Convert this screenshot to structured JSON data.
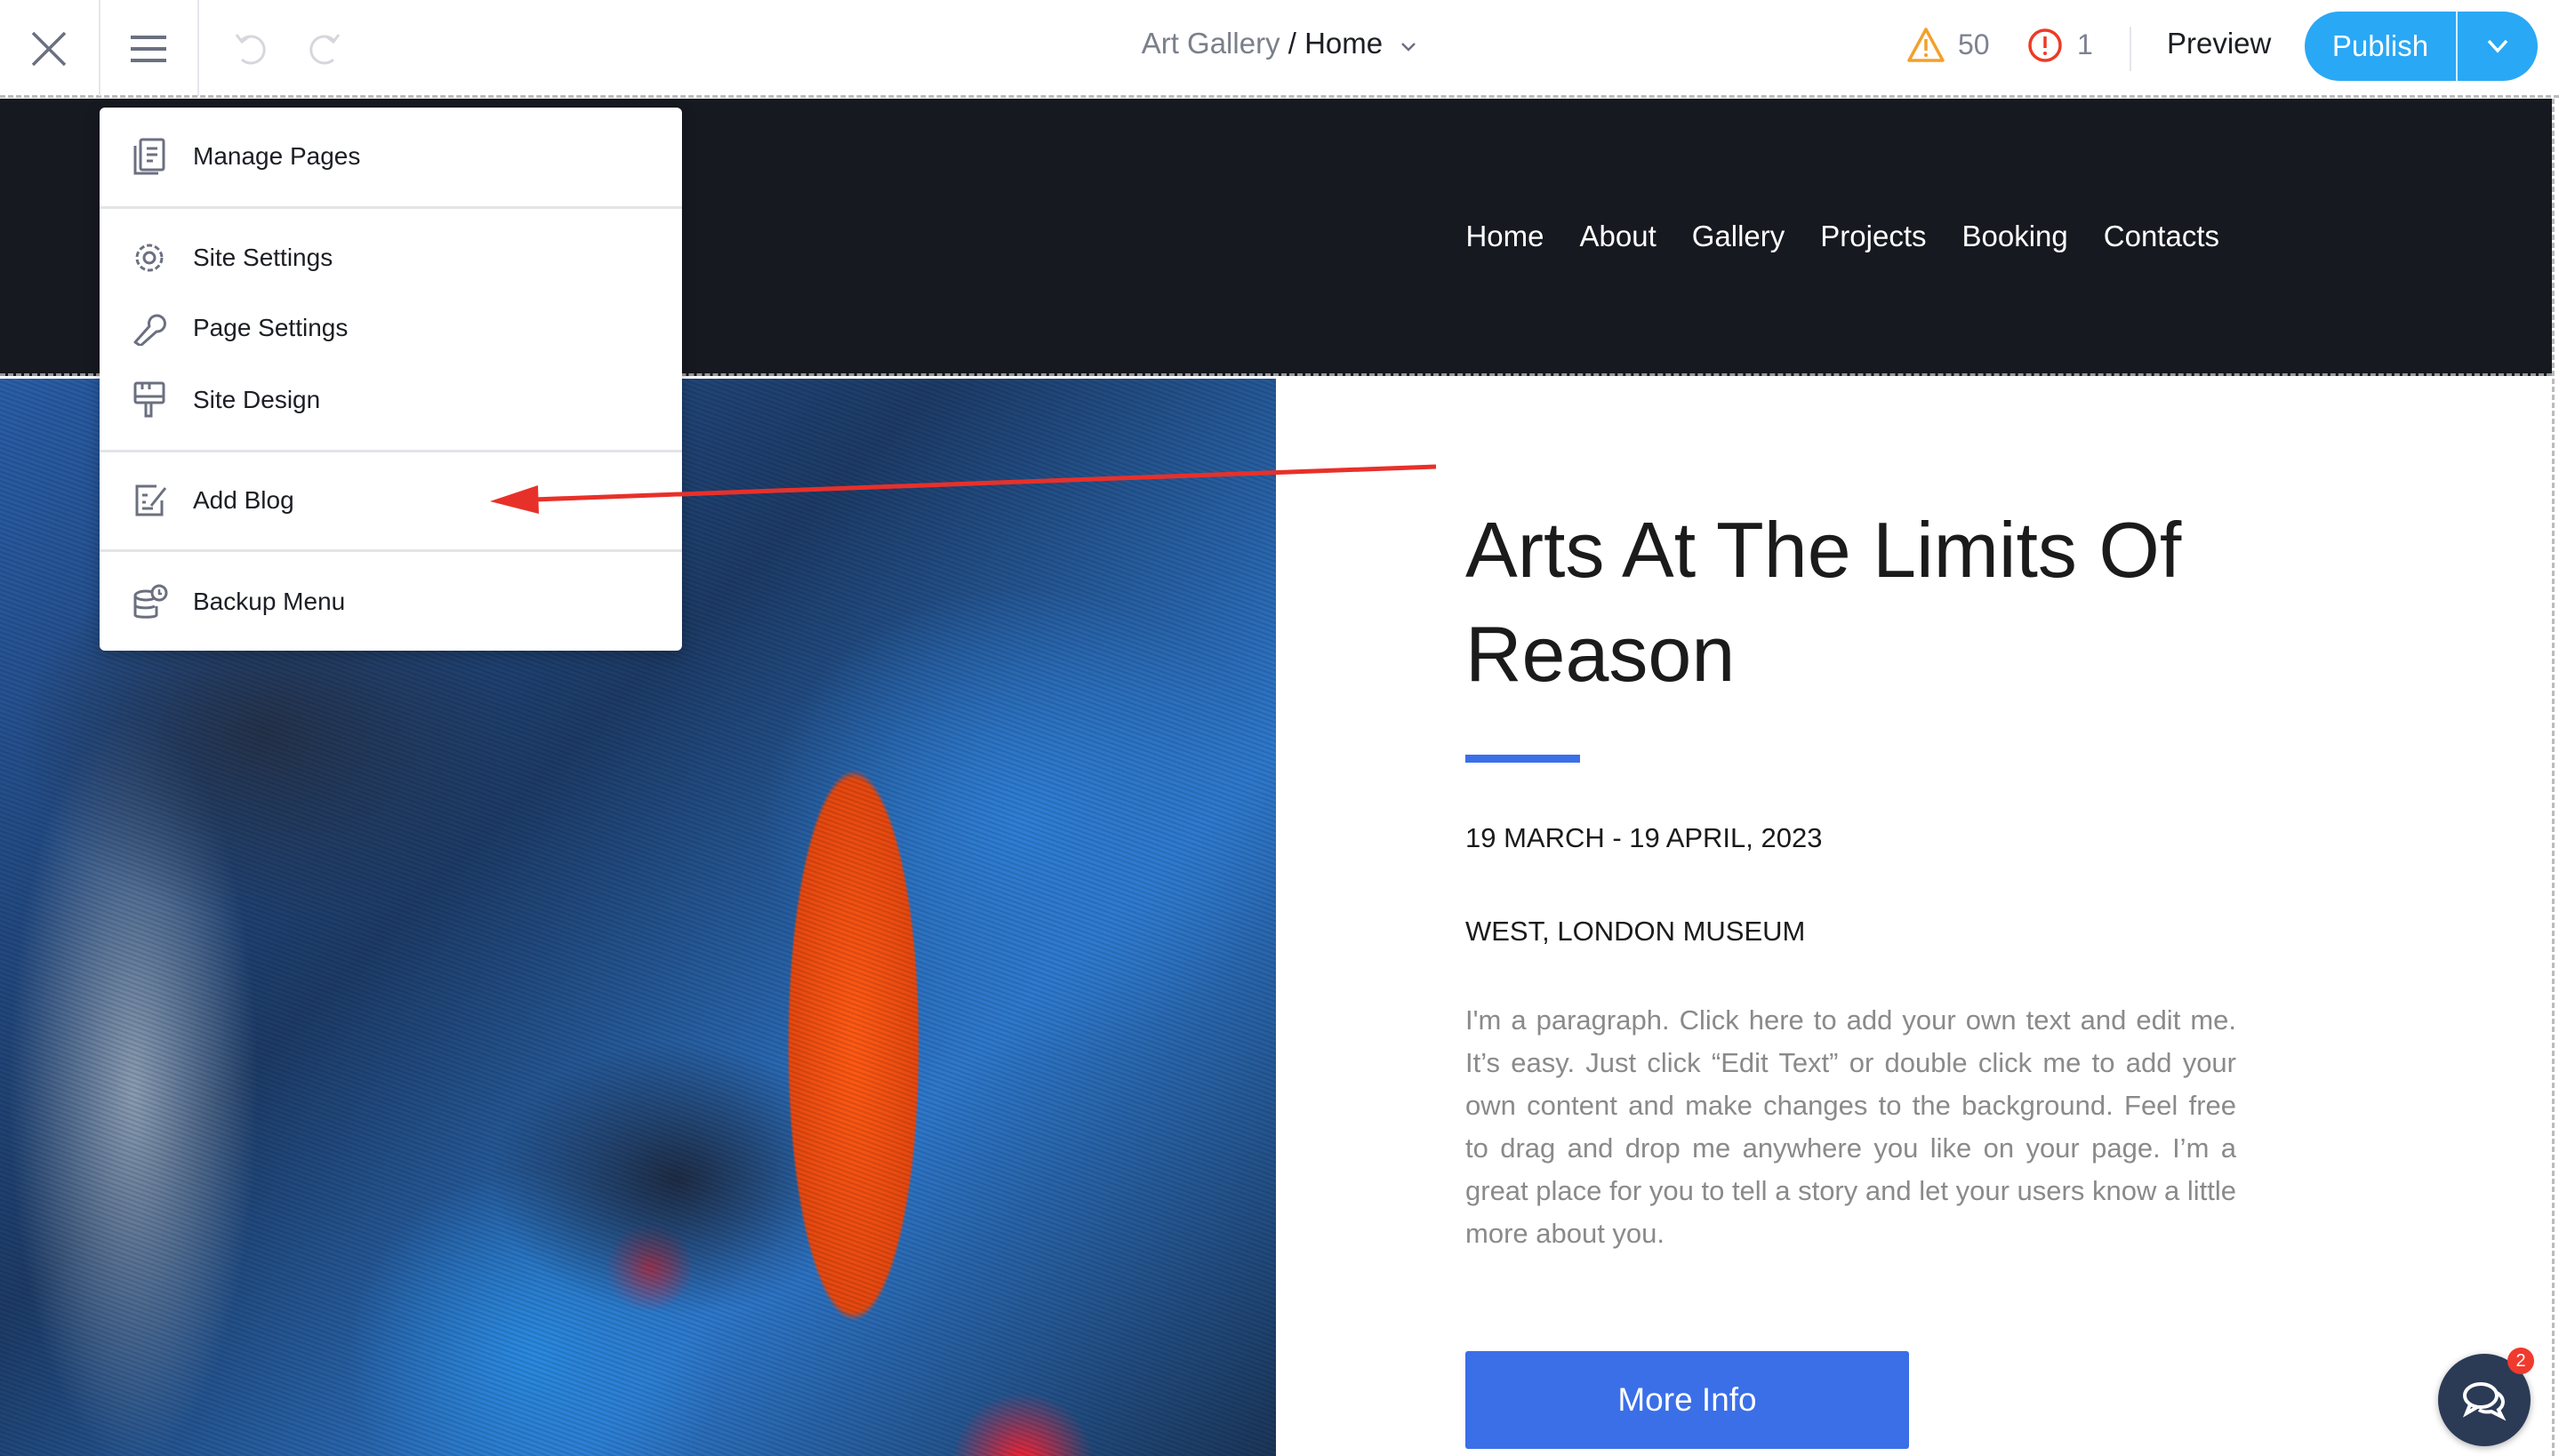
{
  "toolbar": {
    "site_name": "Art Gallery",
    "separator": " / ",
    "page_name": "Home",
    "warnings": "50",
    "errors": "1",
    "preview": "Preview",
    "publish": "Publish",
    "icons": [
      "close-icon",
      "hamburger-menu-icon",
      "undo-icon",
      "redo-icon",
      "chevron-down-icon",
      "warning-icon",
      "error-icon"
    ]
  },
  "menu": {
    "items": [
      {
        "label": "Manage Pages",
        "icon": "pages-icon"
      },
      {
        "label": "Site Settings",
        "icon": "gear-icon"
      },
      {
        "label": "Page Settings",
        "icon": "wrench-icon"
      },
      {
        "label": "Site Design",
        "icon": "paint-brush-icon"
      },
      {
        "label": "Add Blog",
        "icon": "blog-edit-icon"
      },
      {
        "label": "Backup Menu",
        "icon": "backup-icon"
      }
    ]
  },
  "site": {
    "nav": [
      "Home",
      "About",
      "Gallery",
      "Projects",
      "Booking",
      "Contacts"
    ],
    "heading": "Arts At The Limits Of Reason",
    "date": "19 MARCH - 19 APRIL, 2023",
    "location": "WEST, LONDON MUSEUM",
    "paragraph": "I'm a paragraph. Click here to add your own text and edit me. It’s easy. Just click “Edit Text” or double click me to add your own content and make changes to the background. Feel free to drag and drop me anywhere you like on your page. I’m a great place for you to tell a story and let your users know a little more about you.",
    "button": "More Info",
    "accent_color": "#3a6fe8"
  },
  "chat": {
    "badge": "2"
  },
  "colors": {
    "publish": "#29a8f5",
    "header_bg": "#171920",
    "annotation_arrow": "#e8302a"
  }
}
